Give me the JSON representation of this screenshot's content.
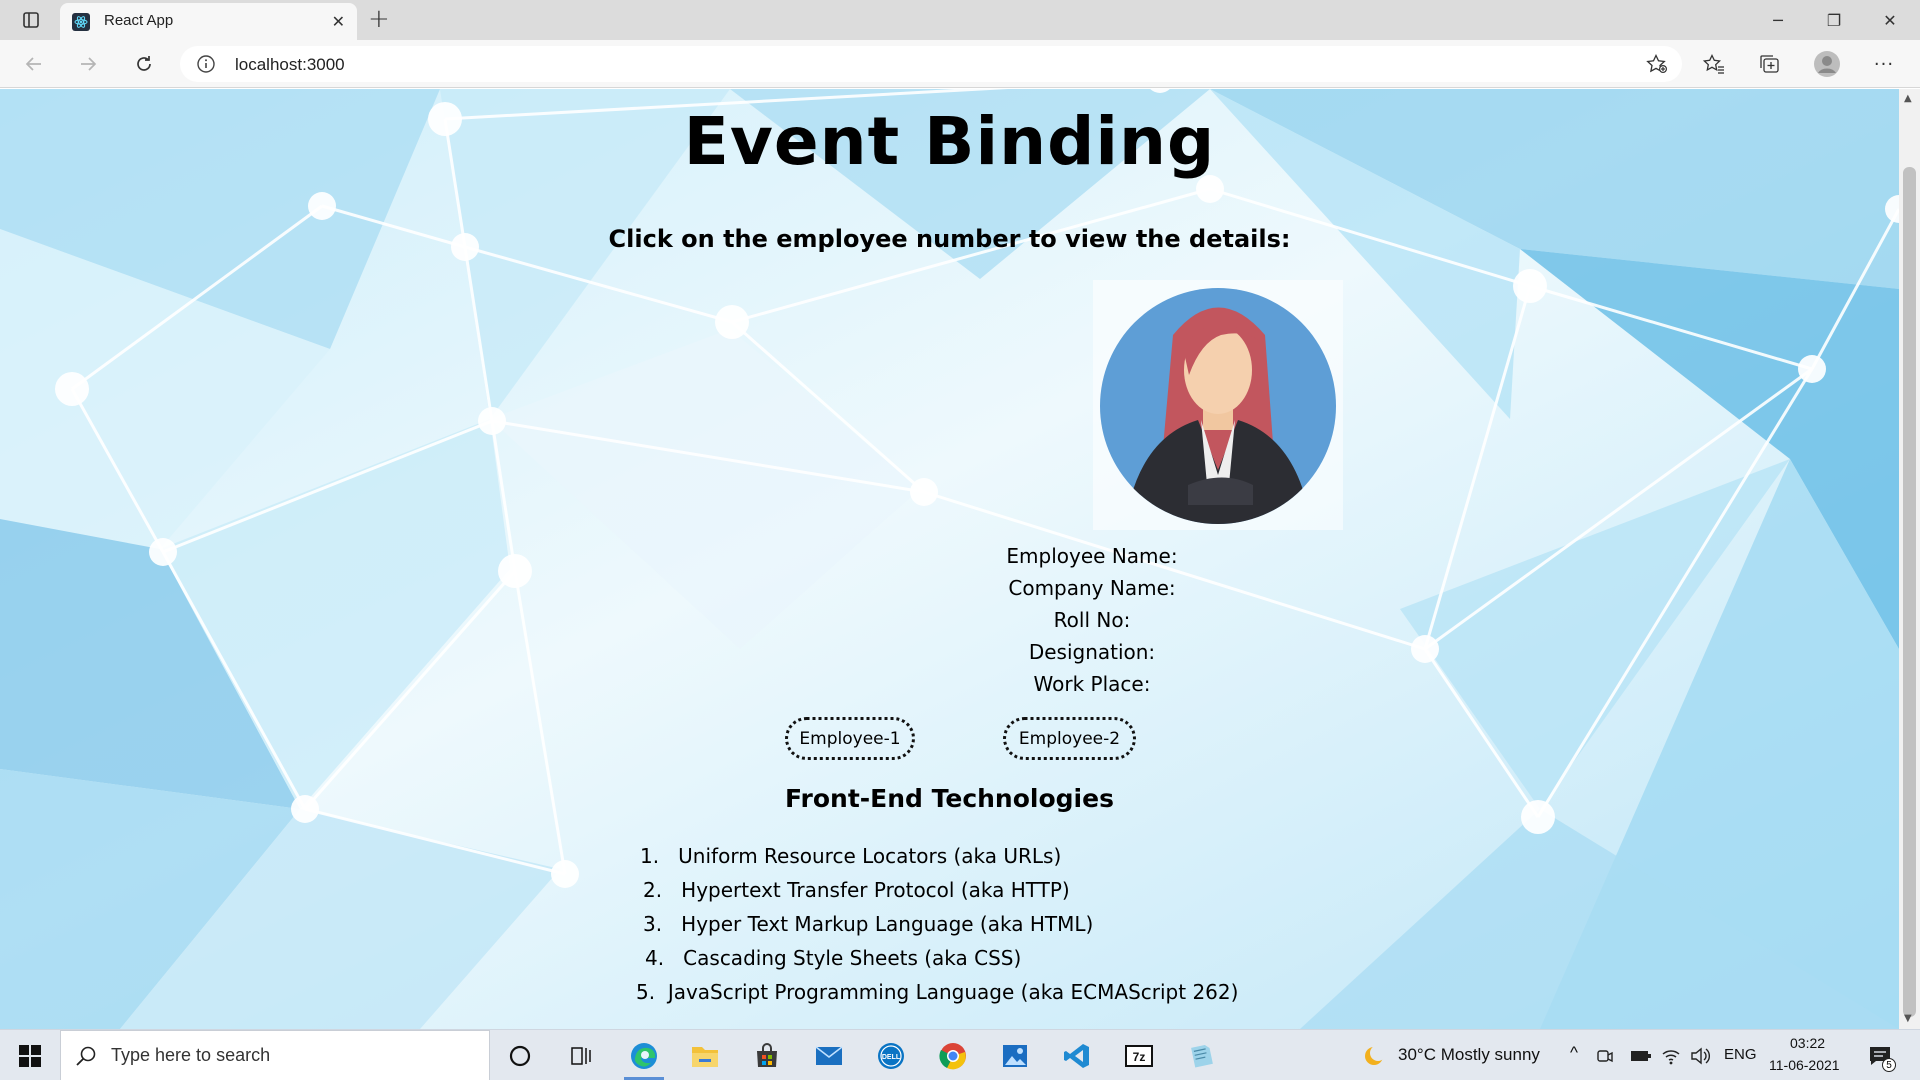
{
  "browser": {
    "tab_title": "React App",
    "tab_close": "✕",
    "new_tab": "+",
    "url": "localhost:3000",
    "window_controls": {
      "minimize": "─",
      "maximize": "❐",
      "close": "✕"
    },
    "more_icon": "···"
  },
  "page": {
    "title": "Event Binding",
    "instruction": "Click on the employee number to view the details:",
    "avatar_icon": "businesswoman-avatar",
    "details": {
      "employee_name": "Employee Name:",
      "company_name": "Company Name:",
      "roll_no": "Roll No:",
      "designation": "Designation:",
      "work_place": "Work Place:"
    },
    "buttons": {
      "employee1": "Employee-1",
      "employee2": "Employee-2"
    },
    "section_title": "Front-End Technologies",
    "technologies": [
      {
        "num": "1.",
        "text": "Uniform Resource Locators (aka URLs)"
      },
      {
        "num": "2.",
        "text": "Hypertext Transfer Protocol (aka HTTP)"
      },
      {
        "num": "3.",
        "text": "Hyper Text Markup Language (aka HTML)"
      },
      {
        "num": "4.",
        "text": "Cascading Style Sheets (aka CSS)"
      },
      {
        "num": "5.",
        "text": "JavaScript Programming Language (aka ECMAScript 262)"
      }
    ]
  },
  "taskbar": {
    "search_placeholder": "Type here to search",
    "weather": "30°C  Mostly sunny",
    "language": "ENG",
    "time": "03:22",
    "date": "11-06-2021",
    "notification_count": "5",
    "apps": [
      "cortana-icon",
      "task-view-icon",
      "edge-icon",
      "file-explorer-icon",
      "store-icon",
      "mail-icon",
      "dell-icon",
      "chrome-icon",
      "photos-icon",
      "vscode-icon",
      "7zip-icon",
      "notepad-icon"
    ]
  },
  "colors": {
    "bg_light": "#e9f6fc",
    "bg_mid": "#a9dcf3",
    "bg_dark": "#5cb8e4",
    "accent": "#0067c0"
  }
}
